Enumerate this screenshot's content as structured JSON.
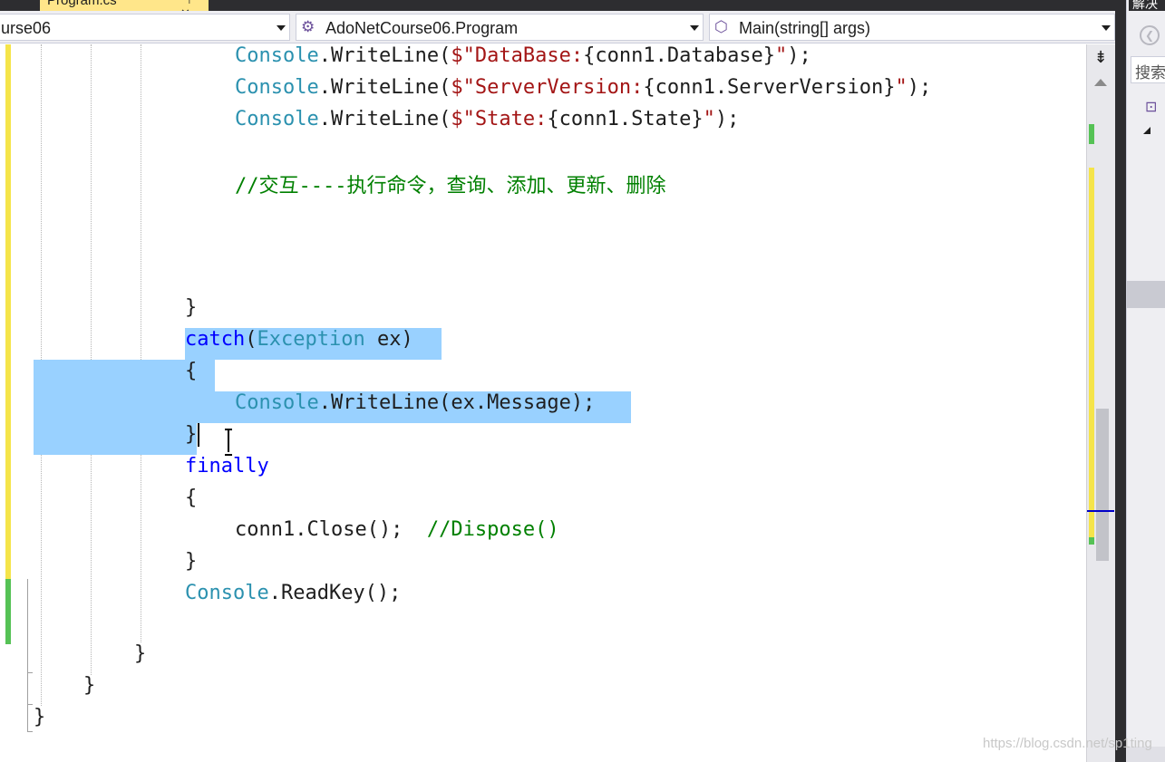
{
  "tab": {
    "label": "Program.cs",
    "icons": "⊣ ✕"
  },
  "navbar": {
    "project_combo": "urse06",
    "class_combo": "AdoNetCourse06.Program",
    "member_combo": "Main(string[] args)"
  },
  "code": {
    "l1": {
      "a": "Console",
      "b": ".WriteLine(",
      "c": "$\"DataBase:",
      "d": "{conn1.Database}",
      "e": "\"",
      "f": ");"
    },
    "l2": {
      "a": "Console",
      "b": ".WriteLine(",
      "c": "$\"ServerVersion:",
      "d": "{conn1.ServerVersion}",
      "e": "\"",
      "f": ");"
    },
    "l3": {
      "a": "Console",
      "b": ".WriteLine(",
      "c": "$\"State:",
      "d": "{conn1.State}",
      "e": "\"",
      "f": ");"
    },
    "l4": {
      "comment": "//交互----执行命令，查询、添加、更新、删除"
    },
    "l5": {
      "brace": "}"
    },
    "l6": {
      "kw": "catch",
      "p1": "(",
      "type": "Exception",
      "rest": " ex)"
    },
    "l7": {
      "brace": "{"
    },
    "l8": {
      "a": "Console",
      "b": ".WriteLine(ex.Message);"
    },
    "l9": {
      "brace": "}"
    },
    "l10": {
      "kw": "finally"
    },
    "l11": {
      "brace": "{"
    },
    "l12": {
      "code": "conn1.Close();  ",
      "comment": "//Dispose()"
    },
    "l13": {
      "brace": "}"
    },
    "l14": {
      "a": "Console",
      "b": ".ReadKey();"
    },
    "l15": {
      "brace": "}"
    },
    "l16": {
      "brace": "}"
    },
    "l17": {
      "brace": "}"
    }
  },
  "scrollbar": {
    "split_glyph": "⇟"
  },
  "right_panel": {
    "title": "解决",
    "search_placeholder": "搜索",
    "back_glyph": "❮"
  },
  "watermark": "https://blog.csdn.net/sp1ting",
  "colors": {
    "selection": "#99d1ff",
    "keyword": "#0000ff",
    "type": "#2b91af",
    "string": "#a31515",
    "comment": "#008000",
    "changed_unsaved": "#f5e44a",
    "changed_saved": "#55c255"
  }
}
